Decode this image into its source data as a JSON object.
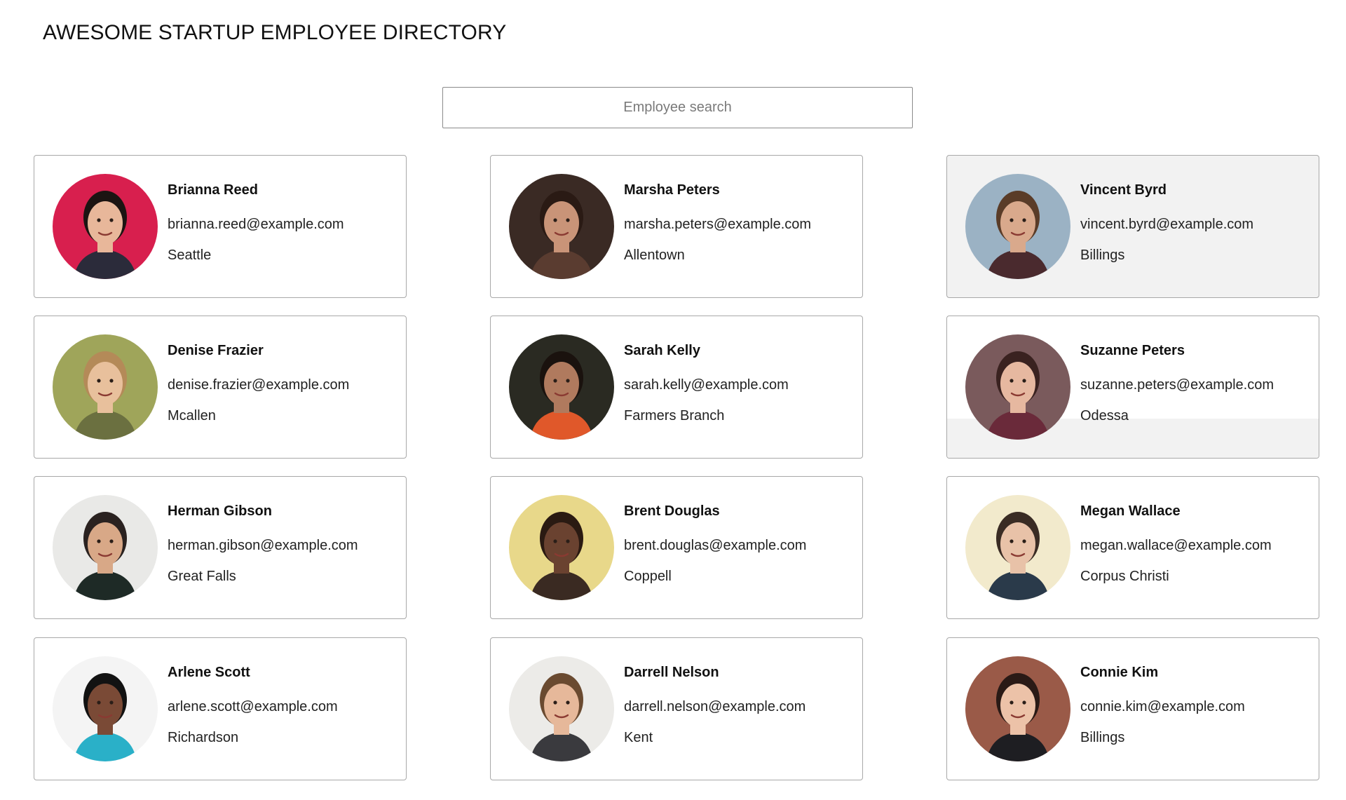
{
  "header": {
    "title": "AWESOME STARTUP EMPLOYEE DIRECTORY"
  },
  "search": {
    "placeholder": "Employee search",
    "value": ""
  },
  "employees": [
    {
      "name": "Brianna Reed",
      "email": "brianna.reed@example.com",
      "location": "Seattle",
      "avatar_bg": "#d81f4e",
      "skin": "#e8b79a",
      "hair": "#1c1412",
      "shirt": "#2b2b3a"
    },
    {
      "name": "Marsha Peters",
      "email": "marsha.peters@example.com",
      "location": "Allentown",
      "avatar_bg": "#3a2a24",
      "skin": "#c99478",
      "hair": "#2a1a14",
      "shirt": "#5a3c30"
    },
    {
      "name": "Vincent Byrd",
      "email": "vincent.byrd@example.com",
      "location": "Billings",
      "avatar_bg": "#9bb2c4",
      "skin": "#d9a98c",
      "hair": "#5a3c28",
      "shirt": "#4a2a2e"
    },
    {
      "name": "Denise Frazier",
      "email": "denise.frazier@example.com",
      "location": "Mcallen",
      "avatar_bg": "#9fa55a",
      "skin": "#e8c09c",
      "hair": "#b48a58",
      "shirt": "#6b7040"
    },
    {
      "name": "Sarah Kelly",
      "email": "sarah.kelly@example.com",
      "location": "Farmers Branch",
      "avatar_bg": "#2a2a22",
      "skin": "#b07a5e",
      "hair": "#1a120e",
      "shirt": "#e0582a"
    },
    {
      "name": "Suzanne Peters",
      "email": "suzanne.peters@example.com",
      "location": "Odessa",
      "avatar_bg": "#7a5a5c",
      "skin": "#e6b8a0",
      "hair": "#3a2220",
      "shirt": "#6a2a3a"
    },
    {
      "name": "Herman Gibson",
      "email": "herman.gibson@example.com",
      "location": "Great Falls",
      "avatar_bg": "#e9e9e7",
      "skin": "#d8a887",
      "hair": "#2a2220",
      "shirt": "#1e2a26"
    },
    {
      "name": "Brent Douglas",
      "email": "brent.douglas@example.com",
      "location": "Coppell",
      "avatar_bg": "#e8d88a",
      "skin": "#6a4230",
      "hair": "#2a1a12",
      "shirt": "#3a2a22"
    },
    {
      "name": "Megan Wallace",
      "email": "megan.wallace@example.com",
      "location": "Corpus Christi",
      "avatar_bg": "#f2eacc",
      "skin": "#e8c2a8",
      "hair": "#3a2c24",
      "shirt": "#2a3a4a"
    },
    {
      "name": "Arlene Scott",
      "email": "arlene.scott@example.com",
      "location": "Richardson",
      "avatar_bg": "#f4f4f4",
      "skin": "#7a4a36",
      "hair": "#121212",
      "shirt": "#2ab0c8"
    },
    {
      "name": "Darrell Nelson",
      "email": "darrell.nelson@example.com",
      "location": "Kent",
      "avatar_bg": "#ecebe8",
      "skin": "#e6b89a",
      "hair": "#6a4a30",
      "shirt": "#3a3a3e"
    },
    {
      "name": "Connie Kim",
      "email": "connie.kim@example.com",
      "location": "Billings",
      "avatar_bg": "#9a5a48",
      "skin": "#ecc2a8",
      "hair": "#2a1a16",
      "shirt": "#1e1e22"
    }
  ]
}
